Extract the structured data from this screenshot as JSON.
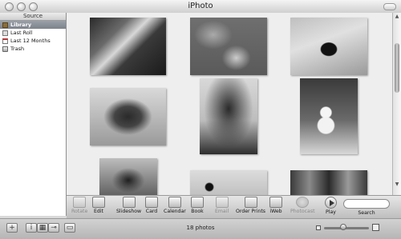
{
  "window": {
    "title": "iPhoto"
  },
  "sidebar": {
    "header": "Source",
    "items": [
      {
        "label": "Library",
        "icon": "library-icon",
        "selected": true
      },
      {
        "label": "Last Roll",
        "icon": "film-roll-icon"
      },
      {
        "label": "Last 12 Months",
        "icon": "calendar-icon"
      },
      {
        "label": "Trash",
        "icon": "trash-icon"
      }
    ]
  },
  "photos": [
    {
      "icon": "photo-dog-on-deck"
    },
    {
      "icon": "photo-two-dogs"
    },
    {
      "icon": "photo-dog-in-snow"
    },
    {
      "icon": "photo-toy-on-snow"
    },
    {
      "icon": "photo-snowy-tree"
    },
    {
      "icon": "photo-snowman"
    },
    {
      "icon": "photo-bird"
    },
    {
      "icon": "photo-sky-figure"
    },
    {
      "icon": "photo-bare-trees"
    }
  ],
  "toolbar": {
    "rotate": "Rotate",
    "edit": "Edit",
    "slideshow": "Slideshow",
    "card": "Card",
    "calendar": "Calendar",
    "book": "Book",
    "email": "Email",
    "order_prints": "Order Prints",
    "iweb": "iWeb",
    "photocast": "Photocast",
    "play": "Play",
    "search": "Search"
  },
  "status": {
    "count": "18 photos"
  },
  "zoom": {
    "level": 0.4
  }
}
